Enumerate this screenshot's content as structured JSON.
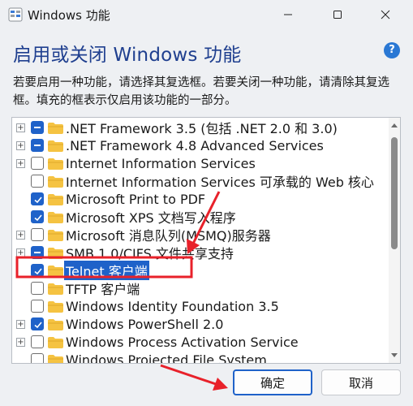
{
  "window": {
    "title": "Windows 功能",
    "minimize_icon": "minimize-icon",
    "maximize_icon": "maximize-icon",
    "close_icon": "close-icon"
  },
  "main": {
    "heading": "启用或关闭 Windows 功能",
    "help_label": "?",
    "description": "若要启用一种功能，请选择其复选框。若要关闭一种功能，请清除其复选框。填充的框表示仅启用该功能的一部分。"
  },
  "features": [
    {
      "label": ".NET Framework 3.5 (包括 .NET 2.0 和 3.0)",
      "expander": "+",
      "state": "partial"
    },
    {
      "label": ".NET Framework 4.8 Advanced Services",
      "expander": "+",
      "state": "partial"
    },
    {
      "label": "Internet Information Services",
      "expander": "+",
      "state": "unchecked"
    },
    {
      "label": "Internet Information Services 可承载的 Web 核心",
      "expander": "",
      "state": "unchecked"
    },
    {
      "label": "Microsoft Print to PDF",
      "expander": "",
      "state": "checked"
    },
    {
      "label": "Microsoft XPS 文档写入程序",
      "expander": "",
      "state": "checked"
    },
    {
      "label": "Microsoft 消息队列(MSMQ)服务器",
      "expander": "+",
      "state": "unchecked"
    },
    {
      "label": "SMB 1.0/CIFS 文件共享支持",
      "expander": "+",
      "state": "partial"
    },
    {
      "label": "Telnet 客户端",
      "expander": "",
      "state": "checked",
      "selected": true
    },
    {
      "label": "TFTP 客户端",
      "expander": "",
      "state": "unchecked"
    },
    {
      "label": "Windows Identity Foundation 3.5",
      "expander": "",
      "state": "unchecked"
    },
    {
      "label": "Windows PowerShell 2.0",
      "expander": "+",
      "state": "checked"
    },
    {
      "label": "Windows Process Activation Service",
      "expander": "+",
      "state": "unchecked"
    },
    {
      "label": "Windows Projected File System",
      "expander": "",
      "state": "unchecked"
    }
  ],
  "footer": {
    "ok_label": "确定",
    "cancel_label": "取消"
  },
  "colors": {
    "accent": "#1f62c9",
    "heading": "#1f3f8f",
    "annotation": "#e8212a",
    "folder": "#f5c342"
  }
}
